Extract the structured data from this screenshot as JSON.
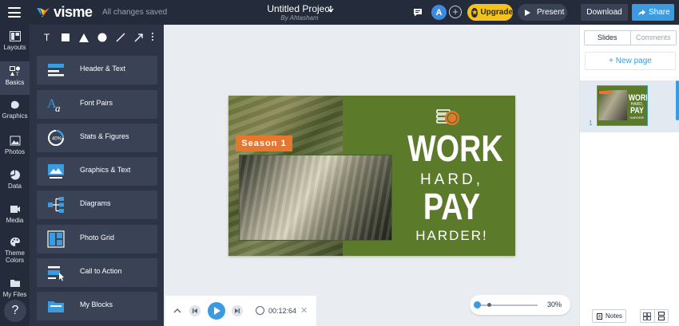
{
  "header": {
    "logo_text": "visme",
    "save_status": "All changes saved",
    "project_title": "Untitled Project",
    "project_author": "By Ahtasham",
    "avatar_initial": "A",
    "add_collaborator": "+",
    "upgrade_label": "Upgrade",
    "present_label": "Present",
    "download_label": "Download",
    "share_label": "Share"
  },
  "rail": {
    "items": [
      {
        "label": "Layouts",
        "icon": "layouts-icon"
      },
      {
        "label": "Basics",
        "icon": "basics-icon"
      },
      {
        "label": "Graphics",
        "icon": "graphics-icon"
      },
      {
        "label": "Photos",
        "icon": "photos-icon"
      },
      {
        "label": "Data",
        "icon": "data-icon"
      },
      {
        "label": "Media",
        "icon": "media-icon"
      },
      {
        "label": "Theme Colors",
        "icon": "palette-icon"
      },
      {
        "label": "My Files",
        "icon": "folder-icon"
      }
    ],
    "active": "Basics",
    "help_label": "?"
  },
  "panel": {
    "tools": [
      "text-tool-icon",
      "rectangle-tool-icon",
      "triangle-tool-icon",
      "circle-tool-icon",
      "line-tool-icon",
      "arrow-tool-icon"
    ],
    "text_tool_label": "T",
    "items": [
      {
        "label": "Header & Text",
        "icon": "header-text-icon"
      },
      {
        "label": "Font Pairs",
        "icon": "font-pairs-icon"
      },
      {
        "label": "Stats & Figures",
        "icon": "stats-figures-icon"
      },
      {
        "label": "Graphics & Text",
        "icon": "graphics-text-icon"
      },
      {
        "label": "Diagrams",
        "icon": "diagrams-icon"
      },
      {
        "label": "Photo Grid",
        "icon": "photo-grid-icon"
      },
      {
        "label": "Call to Action",
        "icon": "call-to-action-icon"
      },
      {
        "label": "My Blocks",
        "icon": "my-blocks-icon"
      }
    ]
  },
  "slide": {
    "badge": "Season 1",
    "line1": "WORK",
    "line2": "HARD,",
    "line3": "PAY",
    "line4": "HARDER!",
    "colors": {
      "background": "#5b7a2a",
      "badge": "#e8772e"
    }
  },
  "player": {
    "time": "00:12:64",
    "close": "✕"
  },
  "zoom": {
    "value": "30%",
    "level": 0.3
  },
  "right_panel": {
    "tabs": [
      {
        "label": "Slides",
        "active": true
      },
      {
        "label": "Comments",
        "active": false
      }
    ],
    "new_page_label": "+ New page",
    "slide_number": "1",
    "thumb": {
      "line1": "WORK",
      "line2": "HARD,",
      "line3": "PAY",
      "line4": "HARDER!"
    },
    "notes_label": "Notes"
  },
  "colors": {
    "accent": "#3b9be0",
    "upgrade": "#f4c21a",
    "topbar": "#242b3a"
  }
}
